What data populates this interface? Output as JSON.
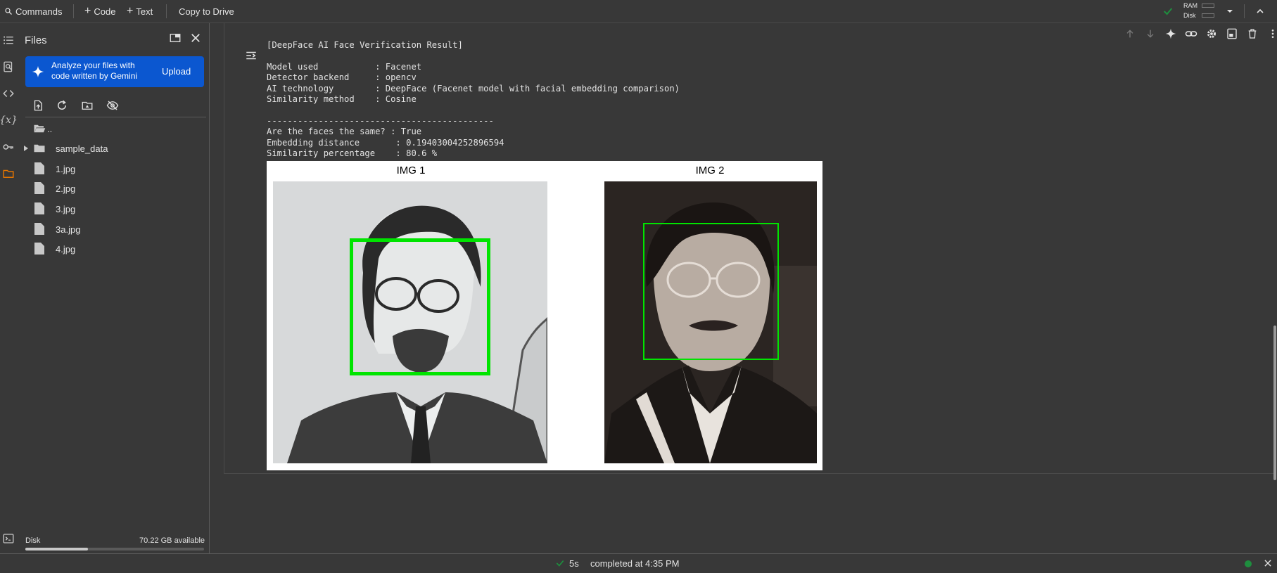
{
  "toolbar": {
    "commands_label": "Commands",
    "code_label": "Code",
    "text_label": "Text",
    "copy_to_drive_label": "Copy to Drive",
    "ram_label": "RAM",
    "disk_label": "Disk"
  },
  "files_panel": {
    "title": "Files",
    "banner_text": "Analyze your files with code written by Gemini",
    "upload_label": "Upload",
    "items": [
      {
        "name": "..",
        "icon": "folder-open-icon"
      },
      {
        "name": "sample_data",
        "icon": "folder-icon"
      },
      {
        "name": "1.jpg",
        "icon": "file-icon"
      },
      {
        "name": "2.jpg",
        "icon": "file-icon"
      },
      {
        "name": "3.jpg",
        "icon": "file-icon"
      },
      {
        "name": "3a.jpg",
        "icon": "file-icon"
      },
      {
        "name": "4.jpg",
        "icon": "file-icon"
      }
    ],
    "disk_label": "Disk",
    "disk_available": "70.22 GB available",
    "disk_used_fraction": 0.35
  },
  "output": {
    "header": "[DeepFace AI Face Verification Result]",
    "details": "Model used           : Facenet\nDetector backend     : opencv\nAI technology        : DeepFace (Facenet model with facial embedding comparison)\nSimilarity method    : Cosine",
    "results": "--------------------------------------------\nAre the faces the same? : True\nEmbedding distance       : 0.19403004252896594\nSimilarity percentage    : 80.6 %",
    "figure": {
      "img1_title": "IMG 1",
      "img2_title": "IMG 2"
    }
  },
  "status": {
    "duration": "5s",
    "completed_text": "completed at 4:35 PM"
  },
  "colors": {
    "background": "#383838",
    "accent_blue": "#0b57d0",
    "success_green": "#1e8e3e",
    "face_box_green": "#00e400",
    "text": "#e3e3e3"
  }
}
